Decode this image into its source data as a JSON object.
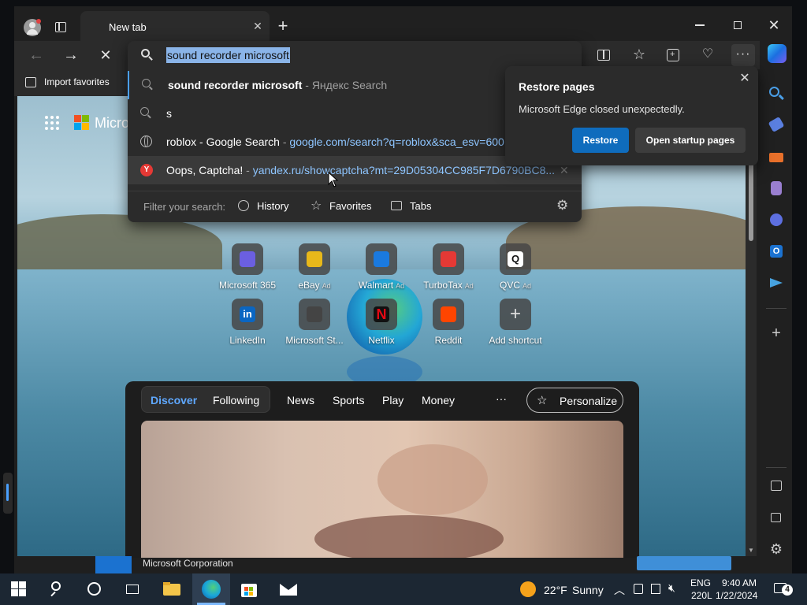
{
  "browser": {
    "tab_title": "New tab",
    "favorites_bar": {
      "import_label": "Import favorites"
    }
  },
  "omnibox": {
    "typed_value": "sound recorder microsoft",
    "suggestions": [
      {
        "bold": "sound recorder microsoft",
        "suffix": " - Яндекс Search",
        "url": ""
      },
      {
        "bold": "s",
        "suffix": "",
        "url": ""
      },
      {
        "bold": "roblox - Google Search",
        "suffix": " - ",
        "url": "google.com/search?q=roblox&sca_esv=600"
      },
      {
        "bold": "Oops, Captcha!",
        "suffix": " - ",
        "url": "yandex.ru/showcaptcha?mt=29D05304CC985F7D6790BC8..."
      }
    ],
    "filter_label": "Filter your search:",
    "filters": [
      "History",
      "Favorites",
      "Tabs"
    ]
  },
  "restore_dialog": {
    "title": "Restore pages",
    "message": "Microsoft Edge closed unexpectedly.",
    "restore_button": "Restore",
    "startup_button": "Open startup pages",
    "accent": "#0f6cbd"
  },
  "newtab": {
    "brand": "Micro",
    "shortcuts": [
      {
        "label": "Microsoft 365",
        "icon": "microsoft365-icon"
      },
      {
        "label": "eBay",
        "ad": "Ad",
        "icon": "ebay-icon"
      },
      {
        "label": "Walmart",
        "ad": "Ad",
        "icon": "walmart-icon"
      },
      {
        "label": "TurboTax",
        "ad": "Ad",
        "icon": "turbotax-icon"
      },
      {
        "label": "QVC",
        "ad": "Ad",
        "icon": "qvc-icon"
      },
      {
        "label": "LinkedIn",
        "icon": "linkedin-icon"
      },
      {
        "label": "Microsoft St...",
        "icon": "microsoft-store-icon"
      },
      {
        "label": "Netflix",
        "icon": "netflix-icon"
      },
      {
        "label": "Reddit",
        "icon": "reddit-icon"
      },
      {
        "label": "Add shortcut",
        "icon": "plus-icon"
      }
    ],
    "feed": {
      "tabs": [
        "Discover",
        "Following",
        "News",
        "Sports",
        "Play",
        "Money"
      ],
      "more": "···",
      "personalize": "Personalize"
    },
    "below_feed": {
      "company": "Microsoft Corporation"
    }
  },
  "taskbar": {
    "weather_temp": "22°F",
    "weather_desc": "Sunny",
    "language": "ENG",
    "layout": "220L",
    "time": "9:40 AM",
    "date": "1/22/2024",
    "notifications": "4"
  }
}
